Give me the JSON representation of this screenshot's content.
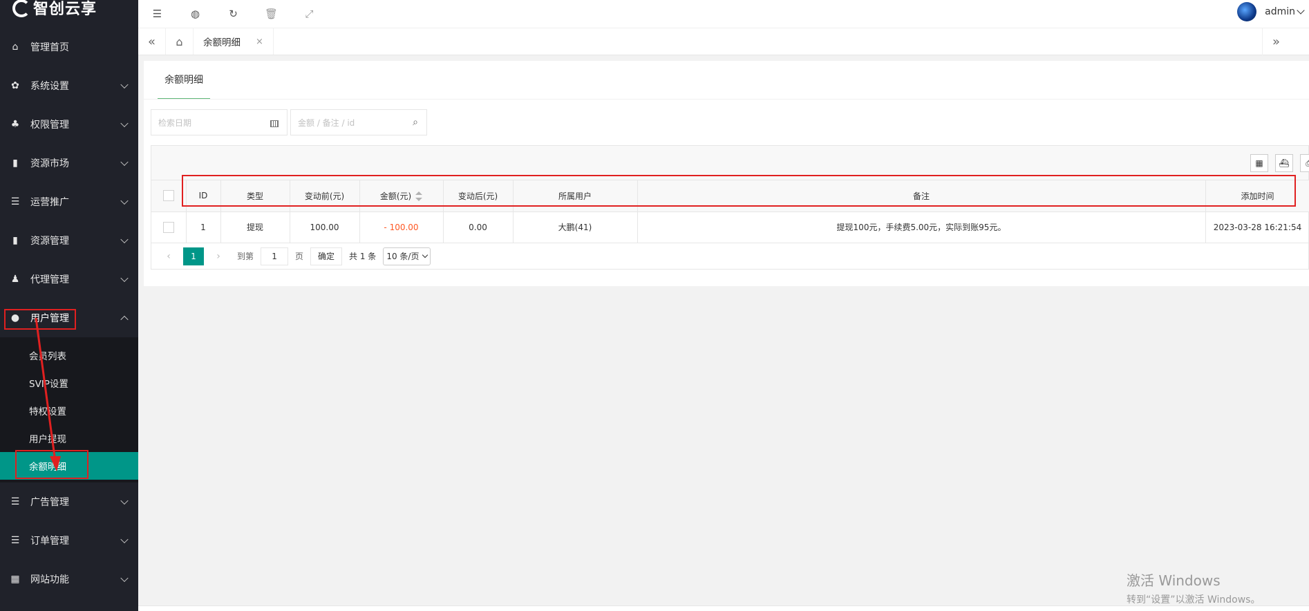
{
  "app": {
    "logo_text": "智创云享"
  },
  "sidebar": {
    "items": [
      {
        "label": "管理首页",
        "icon": "home-icon"
      },
      {
        "label": "系统设置",
        "icon": "gear-icon"
      },
      {
        "label": "权限管理",
        "icon": "permission-icon"
      },
      {
        "label": "资源市场",
        "icon": "book-icon"
      },
      {
        "label": "运营推广",
        "icon": "list-icon"
      },
      {
        "label": "资源管理",
        "icon": "book-icon"
      },
      {
        "label": "代理管理",
        "icon": "agent-icon"
      },
      {
        "label": "用户管理",
        "icon": "user-icon"
      },
      {
        "label": "广告管理",
        "icon": "list-icon"
      },
      {
        "label": "订单管理",
        "icon": "list-icon"
      },
      {
        "label": "网站功能",
        "icon": "apps-icon"
      }
    ],
    "user_sub": [
      "会员列表",
      "SVIP设置",
      "特权设置",
      "用户提现",
      "余额明细"
    ]
  },
  "header": {
    "username": "admin"
  },
  "tabs": {
    "current": "余额明细",
    "close": "×"
  },
  "card": {
    "tab_label": "余额明细"
  },
  "search": {
    "date_placeholder": "检索日期",
    "keyword_placeholder": "金额 / 备注 / id"
  },
  "table": {
    "columns": [
      "ID",
      "类型",
      "变动前(元)",
      "金额(元)",
      "变动后(元)",
      "所属用户",
      "备注",
      "添加时间"
    ],
    "rows": [
      {
        "id": "1",
        "type": "提现",
        "before": "100.00",
        "amount": "- 100.00",
        "after": "0.00",
        "user": "大鹏(41)",
        "remark": "提现100元，手续费5.00元，实际到账95元。",
        "time": "2023-03-28 16:21:54"
      }
    ]
  },
  "pager": {
    "current": "1",
    "goto_label": "到第",
    "goto_value": "1",
    "page_unit": "页",
    "confirm": "确定",
    "total": "共 1 条",
    "limit": "10 条/页"
  },
  "watermark": {
    "line1": "激活 Windows",
    "line2": "转到“设置”以激活 Windows。"
  },
  "colors": {
    "accent": "#009688",
    "sidebar_bg": "#20222a",
    "highlight": "#e02020",
    "negative": "#ff5722"
  }
}
